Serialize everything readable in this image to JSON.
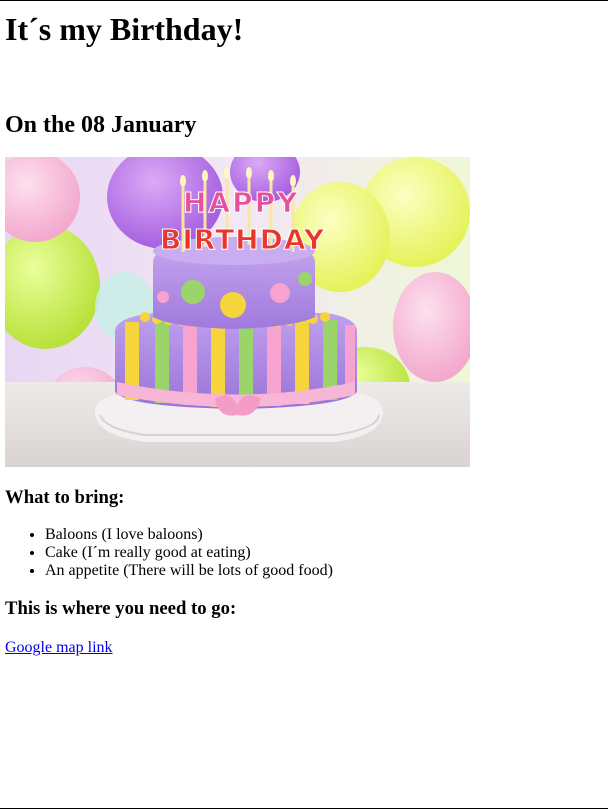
{
  "page": {
    "title": "It´s my Birthday!",
    "date_heading": "On the 08 January",
    "image": {
      "name": "birthday-cake-image",
      "banner_text_top": "HAPPY",
      "banner_text_bottom": "BIRTHDAY",
      "colors": {
        "cake_purple": "#b08be0",
        "cake_pink": "#f6a3cf",
        "cake_yellow": "#f6d53c",
        "cake_green": "#9bd46a",
        "balloon_green": "#c9f24a",
        "balloon_purple": "#b86ee8",
        "balloon_pink": "#f5b3d8"
      }
    },
    "bring_heading": "What to bring:",
    "bring_items": [
      "Baloons (I love baloons)",
      "Cake (I´m really good at eating)",
      "An appetite (There will be lots of good food)"
    ],
    "go_heading": "This is where you need to go:",
    "map_link_text": "Google map link"
  }
}
